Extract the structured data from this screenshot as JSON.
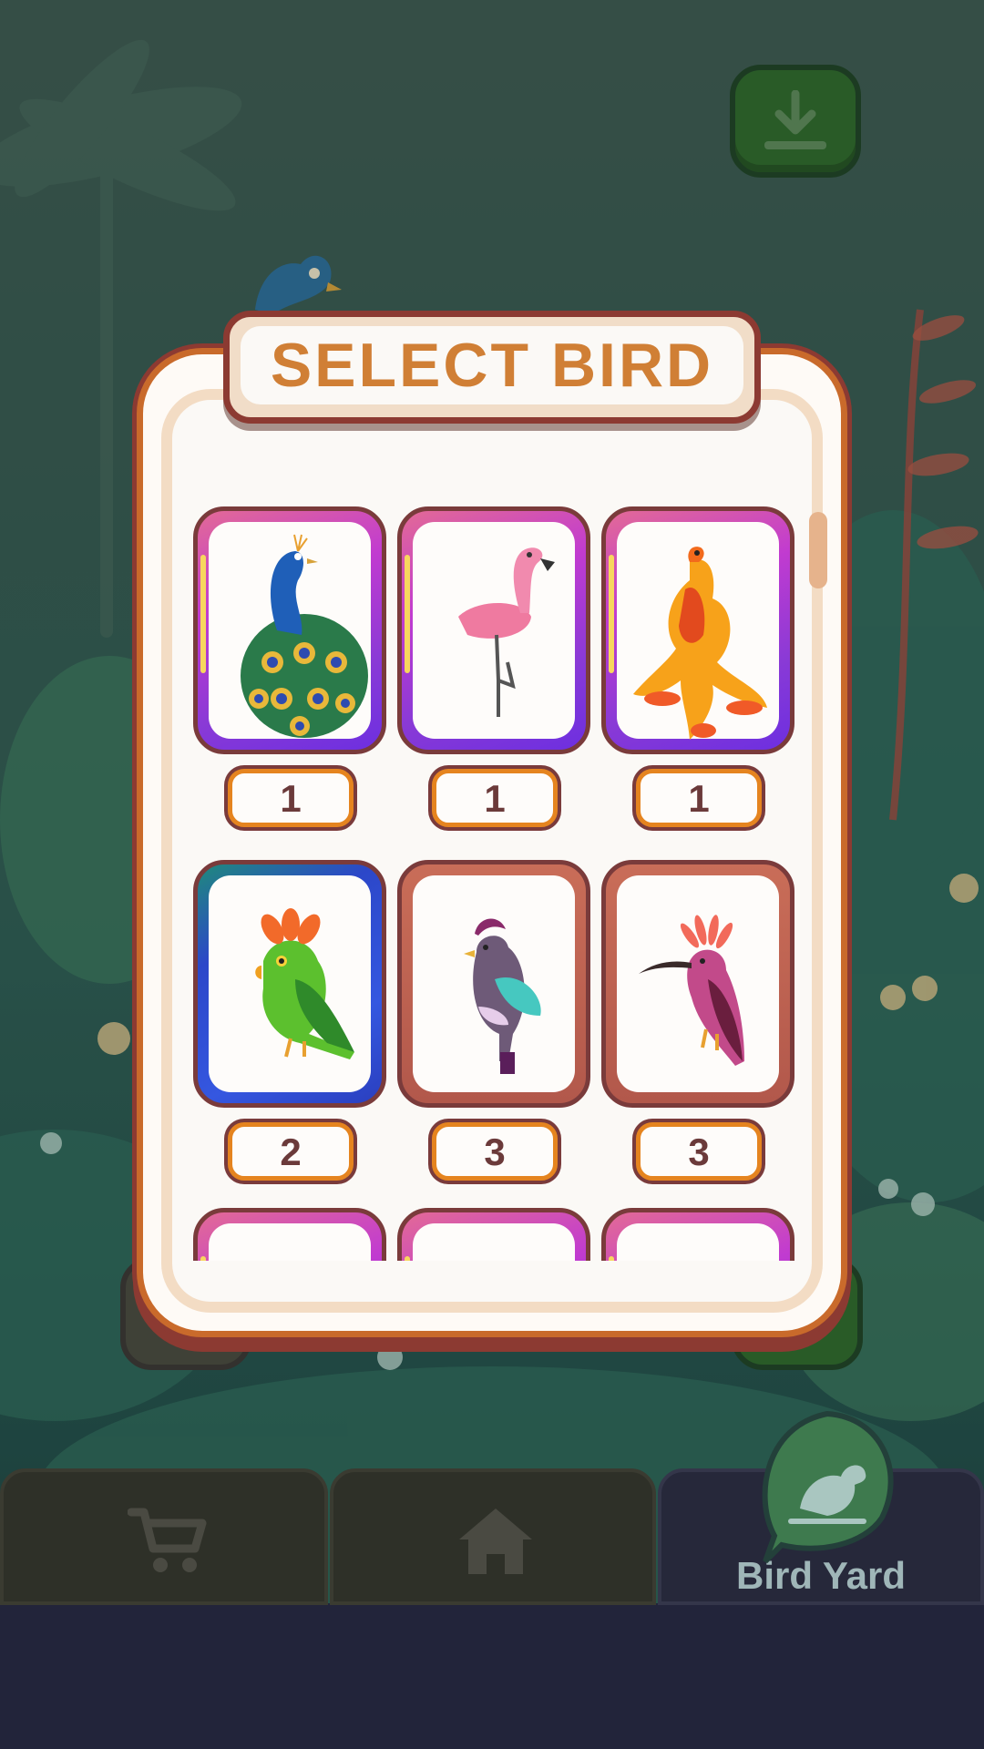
{
  "dialog": {
    "title": "SELECT BIRD"
  },
  "birds": [
    {
      "name": "peacock",
      "count": "1",
      "rarity": "rare"
    },
    {
      "name": "flamingo",
      "count": "1",
      "rarity": "rare"
    },
    {
      "name": "phoenix",
      "count": "1",
      "rarity": "rare"
    },
    {
      "name": "parrot",
      "count": "2",
      "rarity": "blue"
    },
    {
      "name": "pigeon",
      "count": "3",
      "rarity": "plain"
    },
    {
      "name": "hoopoe",
      "count": "3",
      "rarity": "plain"
    },
    {
      "name": "unknown",
      "rarity": "rare"
    },
    {
      "name": "unknown",
      "rarity": "rare"
    },
    {
      "name": "unknown",
      "rarity": "rare"
    }
  ],
  "nav": {
    "tabs": [
      {
        "icon": "cart-icon"
      },
      {
        "icon": "home-icon"
      },
      {
        "icon": "bird-icon",
        "label": "Bird Yard",
        "active": true
      }
    ]
  },
  "icons": {
    "download": "download-icon"
  }
}
